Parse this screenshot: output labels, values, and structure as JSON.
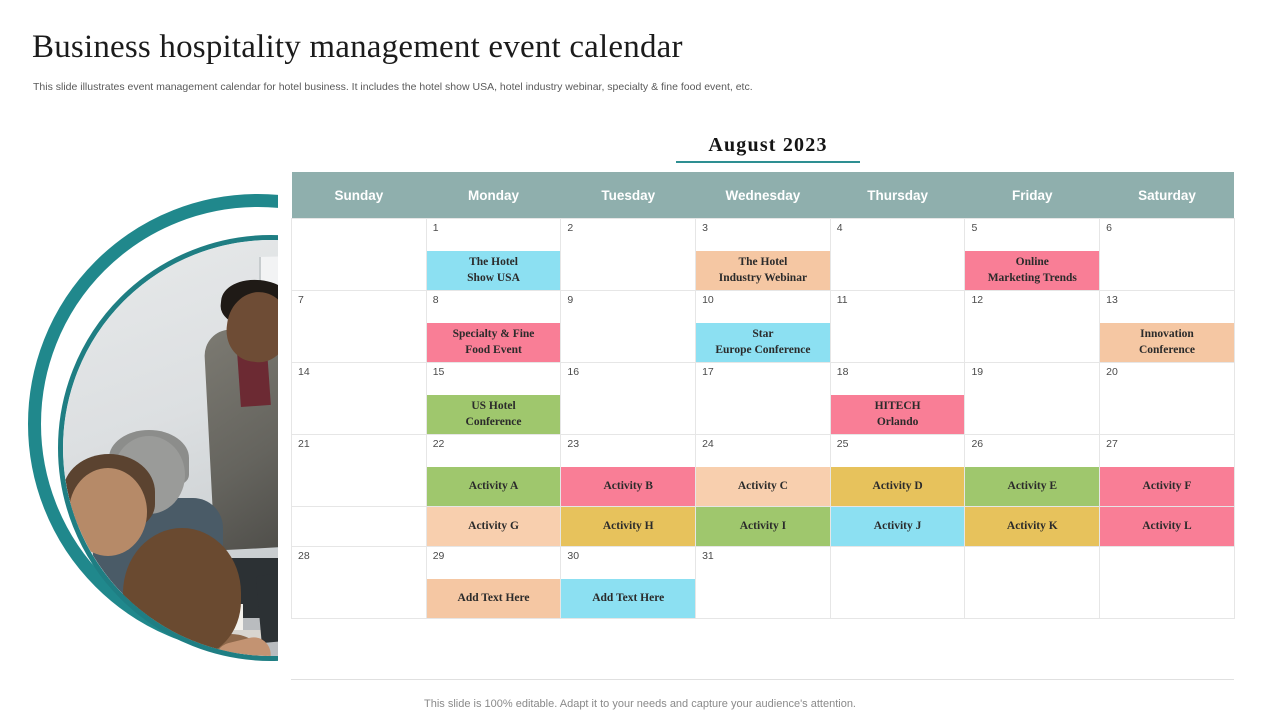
{
  "slide": {
    "title": "Business hospitality management event calendar",
    "subtitle": "This slide illustrates event management calendar for hotel business. It includes the hotel show USA, hotel industry webinar, specialty & fine food event,  etc.",
    "footer": "This slide is 100% editable. Adapt it to your needs and capture your audience's attention."
  },
  "photo": {
    "alt": "business-meeting-presentation-photo",
    "ring_outer_color": "#20888c",
    "ring_inner_color": "#1f7e83"
  },
  "calendar": {
    "month_label": "August 2023",
    "rule_color": "#2e8f92",
    "header_bg": "#8fafad",
    "header_text_color": "#ffffff",
    "day_headers": [
      "Sunday",
      "Monday",
      "Tuesday",
      "Wednesday",
      "Thursday",
      "Friday",
      "Saturday"
    ],
    "palette": {
      "cyan": "#8ce0f2",
      "pink": "#f97e96",
      "peach": "#f5c7a3",
      "peach_light": "#f8cfae",
      "green": "#9fc76d",
      "gold": "#e7c25c"
    },
    "weeks": [
      {
        "dates": [
          "",
          "1",
          "2",
          "3",
          "4",
          "5",
          "6"
        ],
        "events": [
          {
            "lines": [],
            "color": ""
          },
          {
            "lines": [
              "The Hotel",
              "Show USA"
            ],
            "color": "#8ce0f2"
          },
          {
            "lines": [],
            "color": ""
          },
          {
            "lines": [
              "The Hotel",
              "Industry Webinar"
            ],
            "color": "#f5c7a3"
          },
          {
            "lines": [],
            "color": ""
          },
          {
            "lines": [
              "Online",
              "Marketing Trends"
            ],
            "color": "#f97e96"
          },
          {
            "lines": [],
            "color": ""
          }
        ]
      },
      {
        "dates": [
          "7",
          "8",
          "9",
          "10",
          "11",
          "12",
          "13"
        ],
        "events": [
          {
            "lines": [],
            "color": ""
          },
          {
            "lines": [
              "Specialty & Fine",
              "Food Event"
            ],
            "color": "#f97e96"
          },
          {
            "lines": [],
            "color": ""
          },
          {
            "lines": [
              "Star",
              "Europe Conference"
            ],
            "color": "#8ce0f2"
          },
          {
            "lines": [],
            "color": ""
          },
          {
            "lines": [],
            "color": ""
          },
          {
            "lines": [
              "Innovation",
              "Conference"
            ],
            "color": "#f5c7a3"
          }
        ]
      },
      {
        "dates": [
          "14",
          "15",
          "16",
          "17",
          "18",
          "19",
          "20"
        ],
        "events": [
          {
            "lines": [],
            "color": ""
          },
          {
            "lines": [
              "US Hotel",
              "Conference"
            ],
            "color": "#9fc76d"
          },
          {
            "lines": [],
            "color": ""
          },
          {
            "lines": [],
            "color": ""
          },
          {
            "lines": [
              "HITECH",
              "Orlando"
            ],
            "color": "#f97e96"
          },
          {
            "lines": [],
            "color": ""
          },
          {
            "lines": [],
            "color": ""
          }
        ]
      },
      {
        "dates": [
          "21",
          "22",
          "23",
          "24",
          "25",
          "26",
          "27"
        ],
        "events": [
          {
            "lines": [],
            "color": ""
          },
          {
            "lines": [
              "Activity A"
            ],
            "color": "#9fc76d"
          },
          {
            "lines": [
              "Activity B"
            ],
            "color": "#f97e96"
          },
          {
            "lines": [
              "Activity C"
            ],
            "color": "#f8cfae"
          },
          {
            "lines": [
              "Activity D"
            ],
            "color": "#e7c25c"
          },
          {
            "lines": [
              "Activity E"
            ],
            "color": "#9fc76d"
          },
          {
            "lines": [
              "Activity F"
            ],
            "color": "#f97e96"
          }
        ],
        "events2": [
          {
            "lines": [],
            "color": ""
          },
          {
            "lines": [
              "Activity G"
            ],
            "color": "#f8cfae"
          },
          {
            "lines": [
              "Activity H"
            ],
            "color": "#e7c25c"
          },
          {
            "lines": [
              "Activity I"
            ],
            "color": "#9fc76d"
          },
          {
            "lines": [
              "Activity J"
            ],
            "color": "#8ce0f2"
          },
          {
            "lines": [
              "Activity K"
            ],
            "color": "#e7c25c"
          },
          {
            "lines": [
              "Activity L"
            ],
            "color": "#f97e96"
          }
        ]
      },
      {
        "dates": [
          "28",
          "29",
          "30",
          "31",
          "",
          "",
          ""
        ],
        "events": [
          {
            "lines": [],
            "color": ""
          },
          {
            "lines": [
              "Add Text Here"
            ],
            "color": "#f5c7a3"
          },
          {
            "lines": [
              "Add Text Here"
            ],
            "color": "#8ce0f2"
          },
          {
            "lines": [],
            "color": ""
          },
          {
            "lines": [],
            "color": ""
          },
          {
            "lines": [],
            "color": ""
          },
          {
            "lines": [],
            "color": ""
          }
        ]
      }
    ]
  }
}
